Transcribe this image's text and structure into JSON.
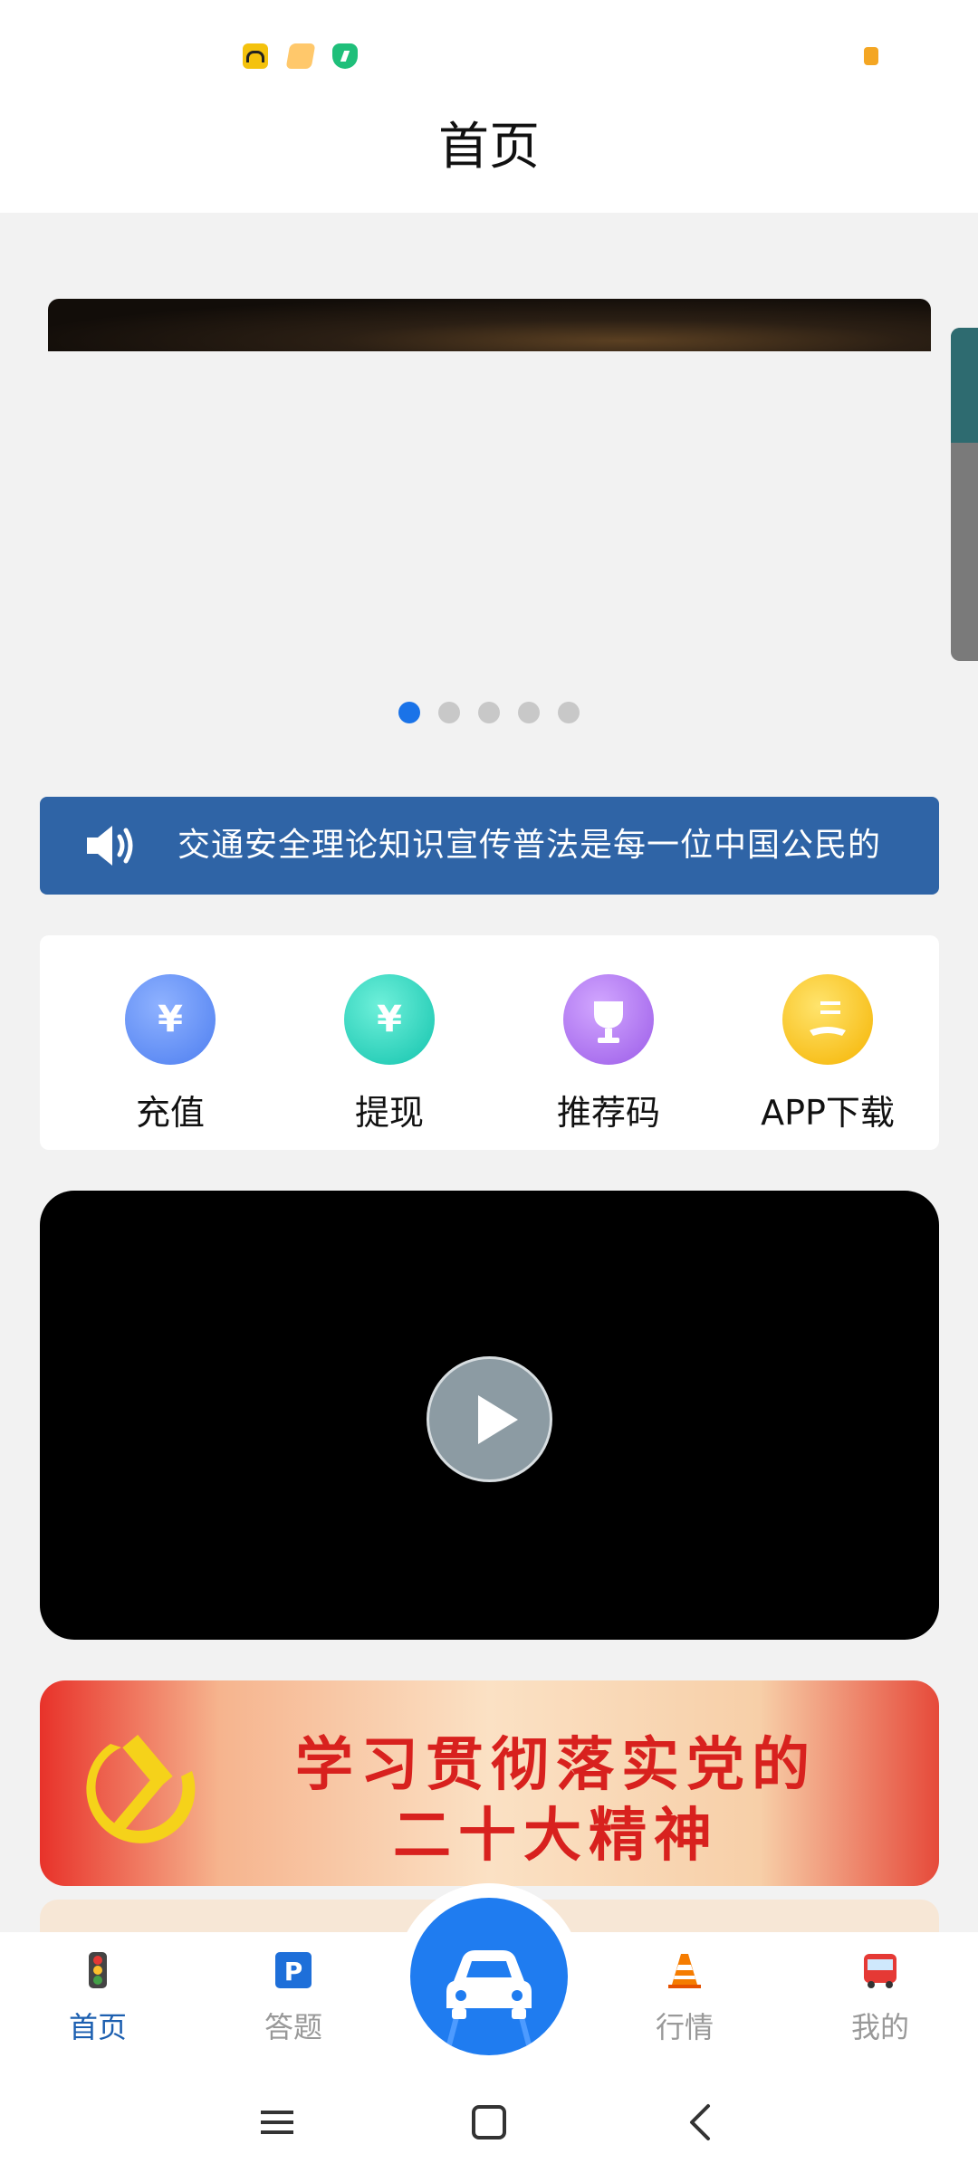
{
  "header": {
    "title": "首页"
  },
  "status_bar": {
    "icons": [
      "car-app-icon",
      "message-icon",
      "security-shield-icon",
      "battery-icon"
    ]
  },
  "carousel": {
    "slide_count": 5,
    "active_index": 0
  },
  "notice": {
    "icon": "speaker-icon",
    "text": "交通安全理论知识宣传普法是每一位中国公民的"
  },
  "quick_actions": [
    {
      "label": "充值",
      "icon": "recharge-icon",
      "color": "#4d7ef0"
    },
    {
      "label": "提现",
      "icon": "withdraw-icon",
      "color": "#12c3ad"
    },
    {
      "label": "推荐码",
      "icon": "trophy-icon",
      "color": "#9b5be8"
    },
    {
      "label": "APP下载",
      "icon": "app-download-icon",
      "color": "#f5b300"
    }
  ],
  "video": {
    "icon": "play-icon"
  },
  "party_banner": {
    "line1": "学习贯彻落实党的",
    "line2": "二十大精神",
    "icon": "hammer-sickle-emblem"
  },
  "tabbar": {
    "items": [
      {
        "label": "首页",
        "icon": "traffic-light-icon",
        "active": true
      },
      {
        "label": "答题",
        "icon": "parking-icon",
        "active": false
      },
      {
        "label": "",
        "icon": "car-icon",
        "active": false
      },
      {
        "label": "行情",
        "icon": "traffic-cone-icon",
        "active": false
      },
      {
        "label": "我的",
        "icon": "bus-icon",
        "active": false
      }
    ]
  },
  "colors": {
    "accent": "#1a73e8",
    "notice_bg": "#2f64a6",
    "tab_active": "#1c5fb0",
    "fab": "#1f7cf0",
    "party_red": "#d8211e"
  }
}
